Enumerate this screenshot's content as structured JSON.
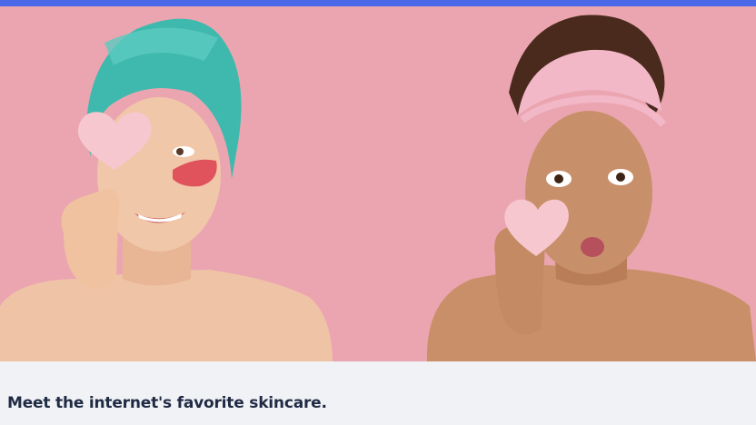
{
  "hero": {
    "image_description_alt": "Two women holding heart-shaped skincare sponges in front of a pink background"
  },
  "headline": "Meet the internet's favorite skincare.",
  "colors": {
    "top_bar": "#4b68e8",
    "hero_background": "#eba5b0",
    "footer_background": "#f0f2f5",
    "headline_text": "#1f2a44"
  },
  "icons": [
    "heart-sponge-icon"
  ]
}
